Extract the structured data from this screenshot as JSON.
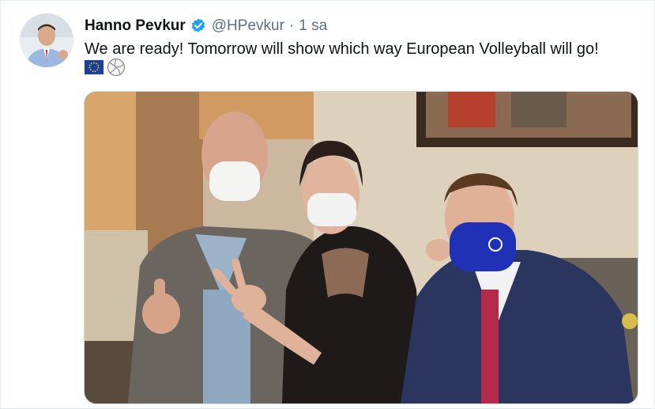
{
  "tweet": {
    "author_name": "Hanno Pevkur",
    "handle": "@HPevkur",
    "separator": "·",
    "time": "1 sa",
    "text": "We are ready! Tomorrow will show which way European Volleyball will go!",
    "verified": true,
    "avatar_icon": "avatar-photo",
    "emoji_1": "eu-flag-icon",
    "emoji_2": "volleyball-icon"
  },
  "colors": {
    "name": "#0f1419",
    "secondary": "#5b7083",
    "verified_blue": "#1da1f2",
    "border": "#e6ecf0"
  }
}
